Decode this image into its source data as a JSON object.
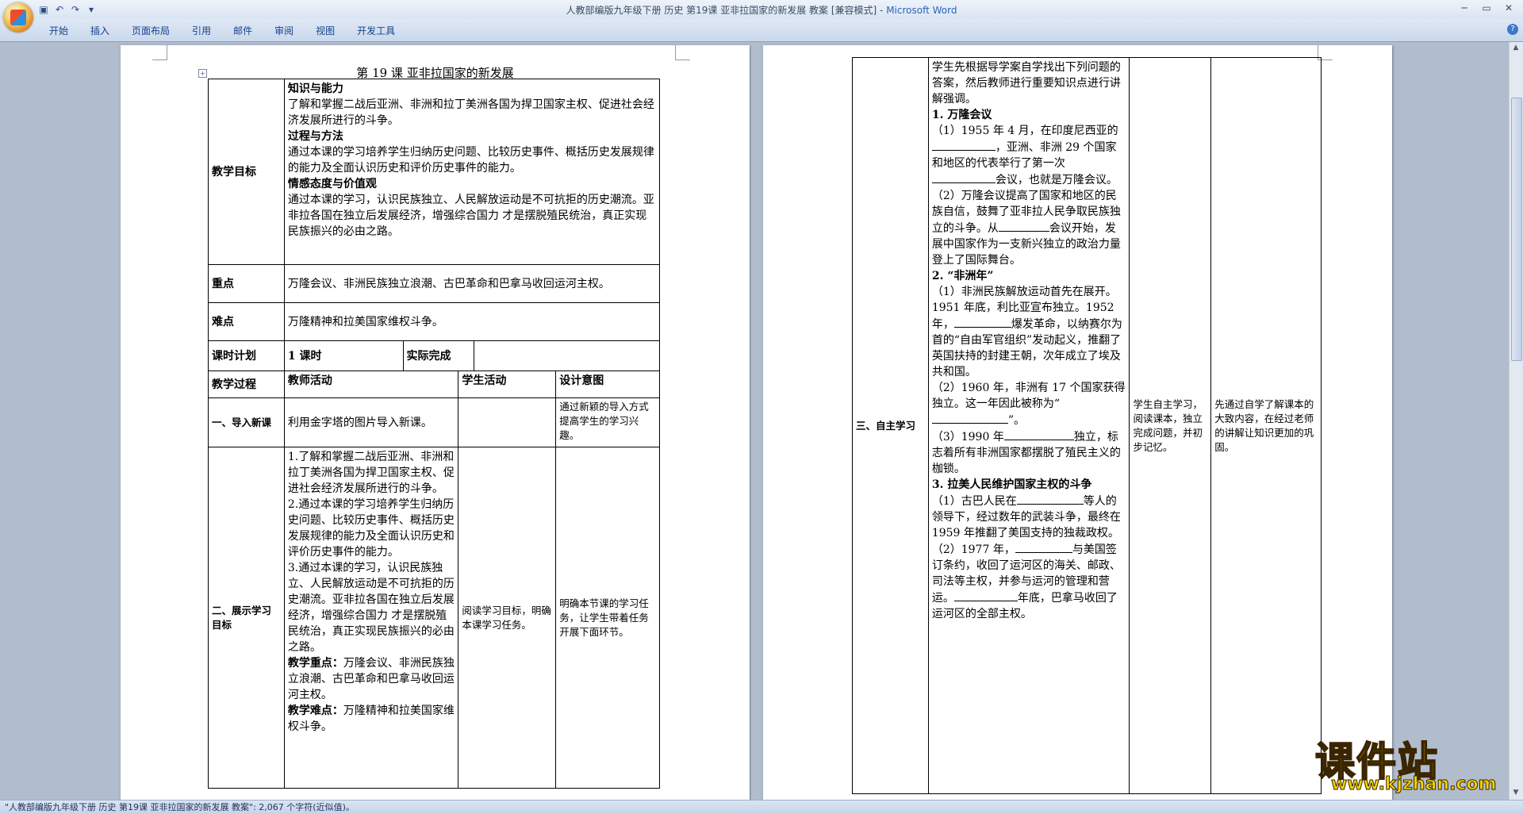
{
  "window": {
    "title": "人教部编版九年级下册 历史 第19课 亚非拉国家的新发展 教案 [兼容模式] - ",
    "app": "Microsoft Word"
  },
  "ribbon_tabs": [
    "开始",
    "插入",
    "页面布局",
    "引用",
    "邮件",
    "审阅",
    "视图",
    "开发工具"
  ],
  "status": {
    "text": "\"人教部编版九年级下册 历史 第19课 亚非拉国家的新发展 教案\": 2,067 个字符(近似值)。"
  },
  "watermark": {
    "cn": "课件站",
    "url": "www.kjzhan.com"
  },
  "page1": {
    "title": "第 19 课    亚非拉国家的新发展",
    "goals_label": "教学目标",
    "goals": {
      "h1": "知识与能力",
      "p1": "了解和掌握二战后亚洲、非洲和拉丁美洲各国为捍卫国家主权、促进社会经济发展所进行的斗争。",
      "h2": "过程与方法",
      "p2": "通过本课的学习培养学生归纳历史问题、比较历史事件、概括历史发展规律的能力及全面认识历史和评价历史事件的能力。",
      "h3": "情感态度与价值观",
      "p3": "通过本课的学习，认识民族独立、人民解放运动是不可抗拒的历史潮流。亚非拉各国在独立后发展经济，增强综合国力    才是摆脱殖民统治，真正实现民族振兴的必由之路。"
    },
    "key_label": "重点",
    "key_text": "万隆会议、非洲民族独立浪潮、古巴革命和巴拿马收回运河主权。",
    "diff_label": "难点",
    "diff_text": "万隆精神和拉美国家维权斗争。",
    "plan_label": "课时计划",
    "plan_value": "1 课时",
    "actual_label": "实际完成",
    "process_label": "教学过程",
    "teacher_label": "教师活动",
    "student_label": "学生活动",
    "design_label": "设计意图",
    "intro_label": "一、导入新课",
    "intro_teacher": "利用金字塔的图片导入新课。",
    "intro_design": "通过新颖的导入方式提高学生的学习兴趣。",
    "goal_label": "二、展示学习目标",
    "goal_teacher_1": "1.了解和掌握二战后亚洲、非洲和拉丁美洲各国为捍卫国家主权、促进社会经济发展所进行的斗争。",
    "goal_teacher_2": "2.通过本课的学习培养学生归纳历史问题、比较历史事件、概括历史发展规律的能力及全面认识历史和评价历史事件的能力。",
    "goal_teacher_3": "3.通过本课的学习，认识民族独立、人民解放运动是不可抗拒的历史潮流。亚非拉各国在独立后发展经济，增强综合国力    才是摆脱殖民统治，真正实现民族振兴的必由之路。",
    "goal_teacher_key_h": "教学重点：",
    "goal_teacher_key": "万隆会议、非洲民族独立浪潮、古巴革命和巴拿马收回运河主权。",
    "goal_teacher_diff_h": "教学难点：",
    "goal_teacher_diff": "万隆精神和拉美国家维权斗争。",
    "goal_student": "阅读学习目标，明确本课学习任务。",
    "goal_design": "明确本节课的学习任务，让学生带着任务开展下面环节。"
  },
  "page2": {
    "self_label": "三、自主学习",
    "intro": "学生先根据导学案自学找出下列问题的答案，然后教师进行重要知识点进行讲解强调。",
    "h1": "1. 万隆会议",
    "p1a": "（1）1955 年 4 月，在印度尼西亚的",
    "p1b": "，亚洲、非洲 29 个国家和地区的代表举行了第一次",
    "p1c": "会议，也就是万隆会议。",
    "p2a": "（2）万隆会议提高了国家和地区的民族自信，鼓舞了亚非拉人民争取民族独立的斗争。从",
    "p2b": "会议开始，发展中国家作为一支新兴独立的政治力量登上了国际舞台。",
    "h2": "2. “非洲年”",
    "p3a": "（1）非洲民族解放运动首先在展开。1951 年底，利比亚宣布独立。1952 年，",
    "p3b": "爆发革命，以纳赛尔为首的“自由军官组织”发动起义，推翻了英国扶持的封建王朝，次年成立了埃及共和国。",
    "p4a": "（2）1960 年，非洲有 17 个国家获得独立。这一年因此被称为“",
    "p4b": "”。",
    "p5a": "（3）1990 年",
    "p5b": "独立，标志着所有非洲国家都摆脱了殖民主义的枷锁。",
    "h3": "3. 拉美人民维护国家主权的斗争",
    "p6a": "（1）古巴人民在",
    "p6b": "等人的领导下，经过数年的武装斗争，最终在 1959 年推翻了美国支持的独裁政权。",
    "p7a": "（2）1977 年，",
    "p7b": "与美国签订条约，收回了运河区的海关、邮政、司法等主权，并参与运河的管理和营运。",
    "p7c": "年底，巴拿马收回了运河区的全部主权。",
    "student": "学生自主学习，阅读课本，独立完成问题，并初步记忆。",
    "design": "先通过自学了解课本的大致内容，在经过老师的讲解让知识更加的巩固。"
  }
}
